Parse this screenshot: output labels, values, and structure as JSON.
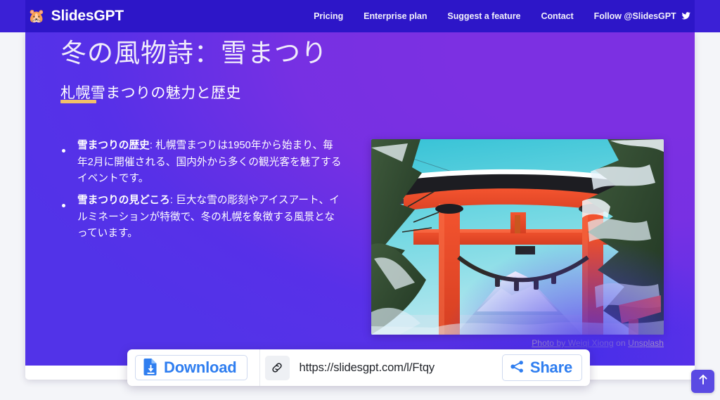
{
  "header": {
    "brand_name": "SlidesGPT",
    "brand_logo_icon": "hamster-face-emoji",
    "nav": [
      {
        "label": "Pricing"
      },
      {
        "label": "Enterprise plan"
      },
      {
        "label": "Suggest a feature"
      },
      {
        "label": "Contact"
      },
      {
        "label": "Follow @SlidesGPT"
      }
    ],
    "twitter_icon": "twitter-bird-icon",
    "bar_color": "#2d16c8",
    "outer_color": "#3b20d6"
  },
  "slide": {
    "title": "冬の風物詩：雪まつり",
    "accent_rule_color": "#f2c069",
    "subtitle": "札幌雪まつりの魅力と歴史",
    "background_from": "#5233e8",
    "background_to": "#7c30e2",
    "bullets": [
      {
        "lead": "雪まつりの歴史",
        "separator": ": ",
        "body": "札幌雪まつりは1950年から始まり、毎年2月に開催される、国内外から多くの観光客を魅了するイベントです。"
      },
      {
        "lead": "雪まつりの見どころ",
        "separator": ": ",
        "body": "巨大な雪の彫刻やアイスアート、イルミネーションが特徴で、冬の札幌を象徴する風景となっています。"
      }
    ],
    "image": {
      "alt_description": "red torii gate in snow with Mount Fuji",
      "credit_prefix": "Photo by",
      "credit_author": "Weiqi Xiong",
      "credit_middle": "on",
      "credit_source": "Unsplash"
    }
  },
  "action_bar": {
    "download_label": "Download",
    "download_icon": "file-download-icon",
    "link_icon": "chain-link-icon",
    "url_value": "https://slidesgpt.com/l/Ftqy",
    "share_label": "Share",
    "share_icon": "share-nodes-icon",
    "accent_color": "#2f7ef0"
  },
  "scroll_top": {
    "icon": "arrow-up-icon",
    "color": "#5a4ae3"
  }
}
